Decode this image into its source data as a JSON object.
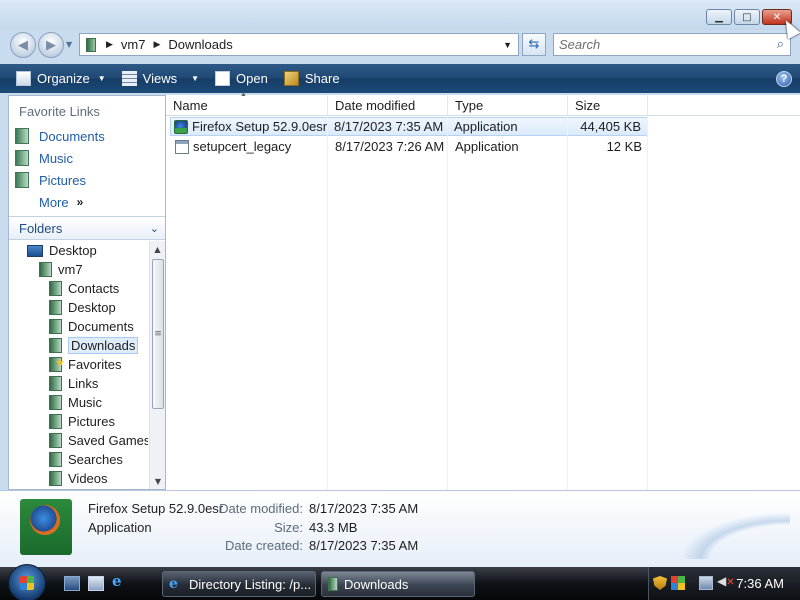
{
  "window": {
    "caption": {
      "minimize": "▁",
      "maximize": "□",
      "close": "✕"
    }
  },
  "address": {
    "crumbs": [
      "vm7",
      "Downloads"
    ],
    "search_placeholder": "Search"
  },
  "toolbar": {
    "organize": "Organize",
    "views": "Views",
    "open": "Open",
    "share": "Share",
    "help": "?"
  },
  "nav": {
    "favorite_links_title": "Favorite Links",
    "favorites": [
      {
        "label": "Documents",
        "icon": "documents-folder-icon"
      },
      {
        "label": "Music",
        "icon": "music-folder-icon"
      },
      {
        "label": "Pictures",
        "icon": "pictures-folder-icon"
      }
    ],
    "more": "More",
    "more_glyph": "»",
    "folders_title": "Folders",
    "tree": [
      {
        "label": "Desktop",
        "level": 0,
        "icon": "desktop-icon"
      },
      {
        "label": "vm7",
        "level": 1,
        "icon": "user-folder-icon"
      },
      {
        "label": "Contacts",
        "level": 2,
        "icon": "contacts-folder-icon"
      },
      {
        "label": "Desktop",
        "level": 2,
        "icon": "desktop-folder-icon"
      },
      {
        "label": "Documents",
        "level": 2,
        "icon": "documents-folder-icon"
      },
      {
        "label": "Downloads",
        "level": 2,
        "icon": "downloads-folder-icon",
        "selected": true
      },
      {
        "label": "Favorites",
        "level": 2,
        "icon": "favorites-folder-icon"
      },
      {
        "label": "Links",
        "level": 2,
        "icon": "links-folder-icon"
      },
      {
        "label": "Music",
        "level": 2,
        "icon": "music-folder-icon"
      },
      {
        "label": "Pictures",
        "level": 2,
        "icon": "pictures-folder-icon"
      },
      {
        "label": "Saved Games",
        "level": 2,
        "icon": "saved-games-folder-icon"
      },
      {
        "label": "Searches",
        "level": 2,
        "icon": "searches-folder-icon"
      },
      {
        "label": "Videos",
        "level": 2,
        "icon": "videos-folder-icon"
      }
    ]
  },
  "files": {
    "columns": {
      "name": "Name",
      "date": "Date modified",
      "type": "Type",
      "size": "Size"
    },
    "rows": [
      {
        "name": "Firefox Setup 52.9.0esr",
        "date": "8/17/2023 7:35 AM",
        "type": "Application",
        "size": "44,405 KB",
        "icon": "firefox-installer-icon",
        "selected": true
      },
      {
        "name": "setupcert_legacy",
        "date": "8/17/2023 7:26 AM",
        "type": "Application",
        "size": "12 KB",
        "icon": "application-icon",
        "selected": false
      }
    ]
  },
  "details": {
    "name": "Firefox Setup 52.9.0esr",
    "type": "Application",
    "date_modified_label": "Date modified:",
    "date_modified": "8/17/2023 7:35 AM",
    "size_label": "Size:",
    "size": "43.3 MB",
    "date_created_label": "Date created:",
    "date_created": "8/17/2023 7:35 AM"
  },
  "taskbar": {
    "items": [
      {
        "label": "Directory Listing: /p...",
        "icon": "internet-explorer-icon"
      },
      {
        "label": "Downloads",
        "icon": "folder-icon"
      }
    ],
    "clock": "7:36 AM"
  }
}
